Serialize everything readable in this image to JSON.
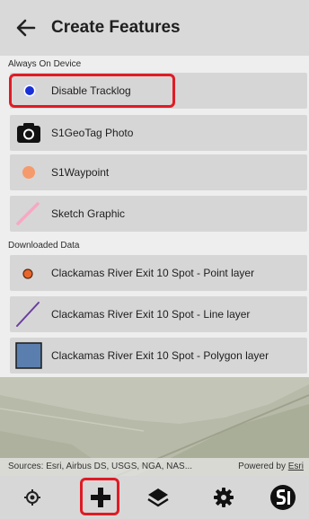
{
  "header": {
    "title": "Create Features",
    "back_icon": "arrow-left-icon"
  },
  "sections": [
    {
      "title": "Always On Device",
      "items": [
        {
          "label": "Disable Tracklog",
          "icon": "tracklog-dot-icon"
        },
        {
          "label": "S1GeoTag Photo",
          "icon": "camera-icon"
        },
        {
          "label": "S1Waypoint",
          "icon": "waypoint-dot-icon"
        },
        {
          "label": "Sketch Graphic",
          "icon": "sketch-line-icon"
        }
      ]
    },
    {
      "title": "Downloaded Data",
      "items": [
        {
          "label": "Clackamas River Exit 10 Spot - Point layer",
          "icon": "point-symbol-icon"
        },
        {
          "label": "Clackamas River Exit 10 Spot - Line layer",
          "icon": "line-symbol-icon"
        },
        {
          "label": "Clackamas River Exit 10 Spot - Polygon layer",
          "icon": "polygon-symbol-icon"
        }
      ]
    }
  ],
  "map": {
    "attribution": "Sources: Esri, Airbus DS, USGS, NGA, NAS...",
    "powered_by": "Powered by",
    "esri_link": "Esri"
  },
  "toolbar": [
    "location-icon",
    "add-icon",
    "layers-icon",
    "settings-icon",
    "s1-logo-icon"
  ],
  "colors": {
    "highlight": "#e01b24",
    "tracklog_dot": "#1a2fd6",
    "waypoint_dot": "#f59a6c",
    "sketch_line": "#f6a8c4",
    "point_symbol": "#e8662b",
    "line_symbol": "#6a3e9e",
    "polygon_symbol": "#5a7fae"
  }
}
